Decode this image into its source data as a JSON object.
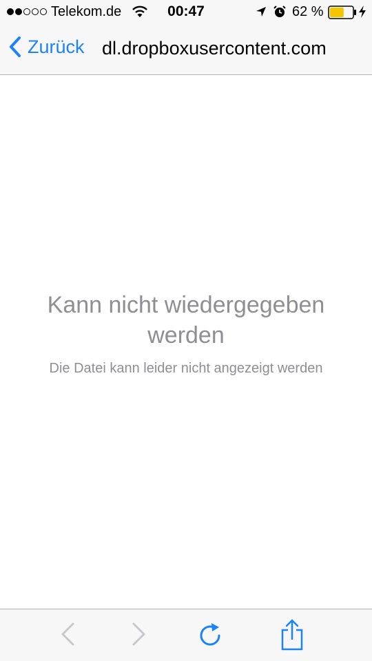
{
  "status_bar": {
    "carrier": "Telekom.de",
    "time": "00:47",
    "battery_percent": "62 %",
    "battery_level": 0.62,
    "signal_bars_filled": 2,
    "signal_bars_total": 5
  },
  "nav": {
    "back_label": "Zurück",
    "title": "dl.dropboxusercontent.com"
  },
  "content": {
    "error_title": "Kann nicht wiedergegeben werden",
    "error_message": "Die Datei kann leider nicht angezeigt werden"
  },
  "toolbar": {
    "back_icon": "chevron-left-icon",
    "forward_icon": "chevron-right-icon",
    "reload_icon": "reload-icon",
    "share_icon": "share-icon"
  },
  "colors": {
    "accent": "#1a82fb",
    "text_secondary": "#8e8e93",
    "disabled": "#c7c7cc",
    "battery_fill": "#f7c500",
    "bar_background": "#f7f7f7"
  }
}
